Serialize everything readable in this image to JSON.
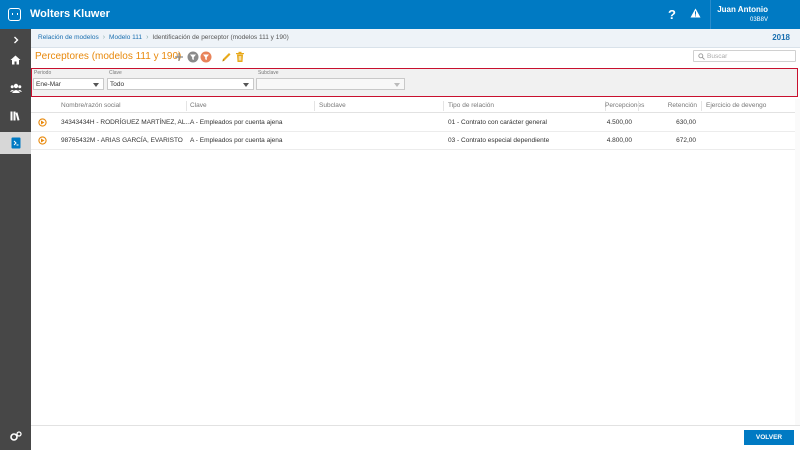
{
  "app": {
    "brand": "Wolters Kluwer",
    "accent": "#007ac3",
    "warning_color": "#c8102e",
    "title_color": "#e8890c"
  },
  "user": {
    "name": "Juan Antonio",
    "code": "03B8V"
  },
  "topbar_icons": [
    "help-icon",
    "warning-icon"
  ],
  "sidebar": {
    "items": [
      {
        "icon": "chevron-right-icon"
      },
      {
        "icon": "home-icon"
      },
      {
        "icon": "users-icon"
      },
      {
        "icon": "library-icon"
      },
      {
        "icon": "document-icon",
        "active": true
      },
      {
        "icon": "settings-icon"
      }
    ]
  },
  "breadcrumb": {
    "items": [
      "Relación de modelos",
      "Modelo 111"
    ],
    "current": "Identificación de perceptor (modelos 111 y 190)",
    "year": "2018"
  },
  "page": {
    "title": "Perceptores (modelos 111 y 190)"
  },
  "toolbar": {
    "icons": [
      "add-icon",
      "filter-icon",
      "clear-filter-icon",
      "edit-icon",
      "delete-icon"
    ]
  },
  "search": {
    "placeholder": "Buscar"
  },
  "filters": {
    "periodo": {
      "label": "Periodo",
      "value": "Ene-Mar"
    },
    "clave": {
      "label": "Clave",
      "value": "Todo"
    },
    "subclave": {
      "label": "Subclave",
      "value": ""
    }
  },
  "table": {
    "columns": [
      "Nombre/razón social",
      "Clave",
      "Subclave",
      "Tipo de relación",
      "Percepciones",
      "Retención",
      "Ejercicio de devengo"
    ],
    "rows": [
      {
        "nombre": "34343434H - RODRÍGUEZ MARTÍNEZ, AL...",
        "clave": "A - Empleados por cuenta ajena",
        "subclave": "",
        "tipo": "01 - Contrato con carácter general",
        "percepciones": "4.500,00",
        "retencion": "630,00",
        "ejercicio": ""
      },
      {
        "nombre": "98765432M - ARIAS GARCÍA, EVARISTO",
        "clave": "A - Empleados por cuenta ajena",
        "subclave": "",
        "tipo": "03 - Contrato especial dependiente",
        "percepciones": "4.800,00",
        "retencion": "672,00",
        "ejercicio": ""
      }
    ]
  },
  "footer": {
    "back_label": "VOLVER"
  }
}
